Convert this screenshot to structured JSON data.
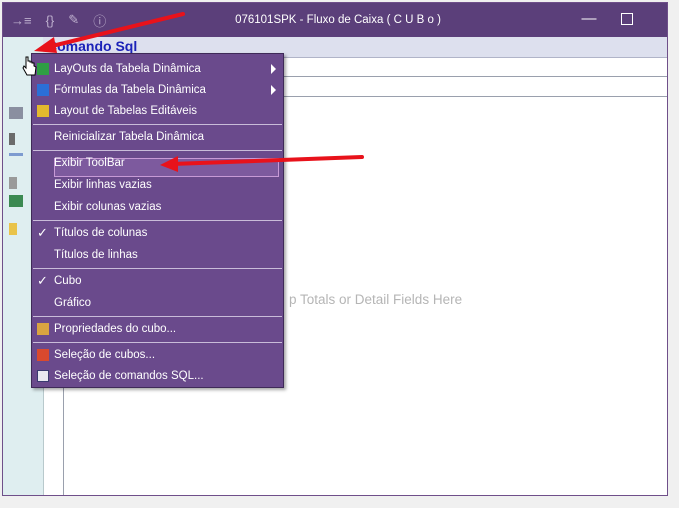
{
  "window": {
    "title": "076101SPK - Fluxo de Caixa ( C U B o )",
    "minimize_glyph": "—",
    "title_icons": [
      "pin-icon",
      "braces-icon",
      "wrench-icon",
      "info-icon"
    ]
  },
  "panel": {
    "title": "Comando Sql",
    "drop_hint": "p Totals or Detail Fields Here"
  },
  "menu": {
    "items": [
      {
        "label": "LayOuts da Tabela Dinâmica",
        "icon": "layouts-icon",
        "submenu": true
      },
      {
        "label": "Fórmulas da Tabela Dinâmica",
        "icon": "formulas-icon",
        "submenu": true
      },
      {
        "label": "Layout de Tabelas Editáveis",
        "icon": "editable-tables-icon"
      },
      {
        "label": "Reinicializar Tabela Dinâmica"
      },
      {
        "label": "Exibir ToolBar"
      },
      {
        "label": "Exibir linhas vazias"
      },
      {
        "label": "Exibir colunas vazias"
      },
      {
        "label": "Títulos de colunas",
        "checked": true
      },
      {
        "label": "Títulos de linhas"
      },
      {
        "label": "Cubo",
        "checked": true
      },
      {
        "label": "Gráfico"
      },
      {
        "label": "Propriedades do cubo...",
        "icon": "properties-icon"
      },
      {
        "label": "Seleção de cubos...",
        "icon": "cube-selection-icon"
      },
      {
        "label": "Seleção de comandos SQL...",
        "icon": "sql-icon"
      }
    ],
    "check_glyph": "✓"
  },
  "colors": {
    "titlebar": "#5b3f7a",
    "menu_bg": "#6a4a8c",
    "panel_title": "#1b22b8",
    "annotation_arrow": "#e8121b"
  }
}
